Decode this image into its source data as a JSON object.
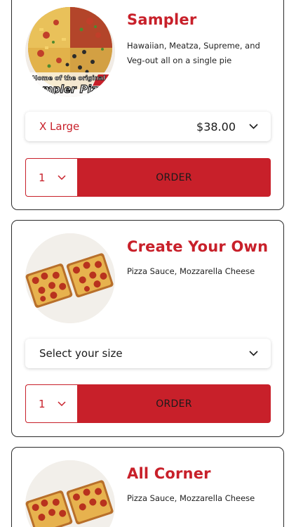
{
  "colors": {
    "accent": "#c8202a",
    "text": "#1a1a1a",
    "border": "#2a2a2a"
  },
  "icons": {
    "dropdown": "chevron-down-icon"
  },
  "items": [
    {
      "name": "Sampler",
      "description": "Hawaiian, Meatza, Supreme, and Veg-out all on a single pie",
      "image_text_line1": "Home of the original",
      "image_text_line2": "Sampler Pizza",
      "size_label": "X Large",
      "price": "$38.00",
      "quantity": "1",
      "order_label": "ORDER"
    },
    {
      "name": "Create Your Own",
      "description": "Pizza Sauce, Mozzarella Cheese",
      "size_label": "Select your size",
      "quantity": "1",
      "order_label": "ORDER"
    },
    {
      "name": "All Corner",
      "description": "Pizza Sauce, Mozzarella Cheese"
    }
  ]
}
